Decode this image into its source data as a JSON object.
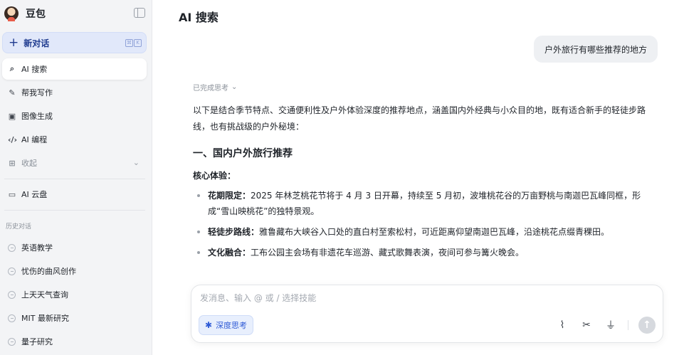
{
  "app": {
    "name": "豆包"
  },
  "sidebar": {
    "new_chat": {
      "label": "新对话",
      "shortcut": [
        "⌘",
        "K"
      ]
    },
    "nav": [
      {
        "label": "AI 搜索",
        "icon": "search-sparkle-icon",
        "active": true
      },
      {
        "label": "帮我写作",
        "icon": "pen-icon"
      },
      {
        "label": "图像生成",
        "icon": "image-icon"
      },
      {
        "label": "AI 编程",
        "icon": "code-icon"
      },
      {
        "label": "收起",
        "icon": "grid-icon"
      }
    ],
    "cloud": {
      "label": "AI 云盘",
      "icon": "cloud-drive-icon"
    },
    "history_title": "历史对话",
    "history": [
      "英语教学",
      "忧伤的曲风创作",
      "上天天气查询",
      "MIT 最新研究",
      "量子研究"
    ]
  },
  "main": {
    "title": "AI 搜索",
    "user_message": "户外旅行有哪些推荐的地方",
    "think_status": "已完成思考",
    "intro": "以下是结合季节特点、交通便利性及户外体验深度的推荐地点，涵盖国内外经典与小众目的地，既有适合新手的轻徒步路线，也有挑战级的户外秘境：",
    "section_title": "一、国内户外旅行推荐",
    "subsection_title": "核心体验：",
    "bullets": [
      {
        "term": "花期限定：",
        "text": "2025 年林芝桃花节将于 4 月 3 日开幕，持续至 5 月初，波堆桃花谷的万亩野桃与南迦巴瓦峰同框，形成“雪山映桃花”的独特景观。"
      },
      {
        "term": "轻徒步路线：",
        "text": "雅鲁藏布大峡谷入口处的直白村至索松村，可近距离仰望南迦巴瓦峰，沿途桃花点缀青稞田。"
      },
      {
        "term": "文化融合：",
        "text": "工布公园主会场有非遗花车巡游、藏式歌舞表演，夜间可参与篝火晚会。"
      }
    ]
  },
  "composer": {
    "placeholder": "发消息、输入 @ 或 / 选择技能",
    "deep_think_label": "深度思考",
    "tools": [
      "attachment-icon",
      "scissors-icon",
      "microphone-icon"
    ],
    "send_icon": "arrow-up-icon"
  },
  "colors": {
    "accent": "#2f5bd6",
    "new_chat_bg": "#e1e8fa",
    "sidebar_bg": "#f3f4f6",
    "user_bubble_bg": "#eef0f3"
  }
}
